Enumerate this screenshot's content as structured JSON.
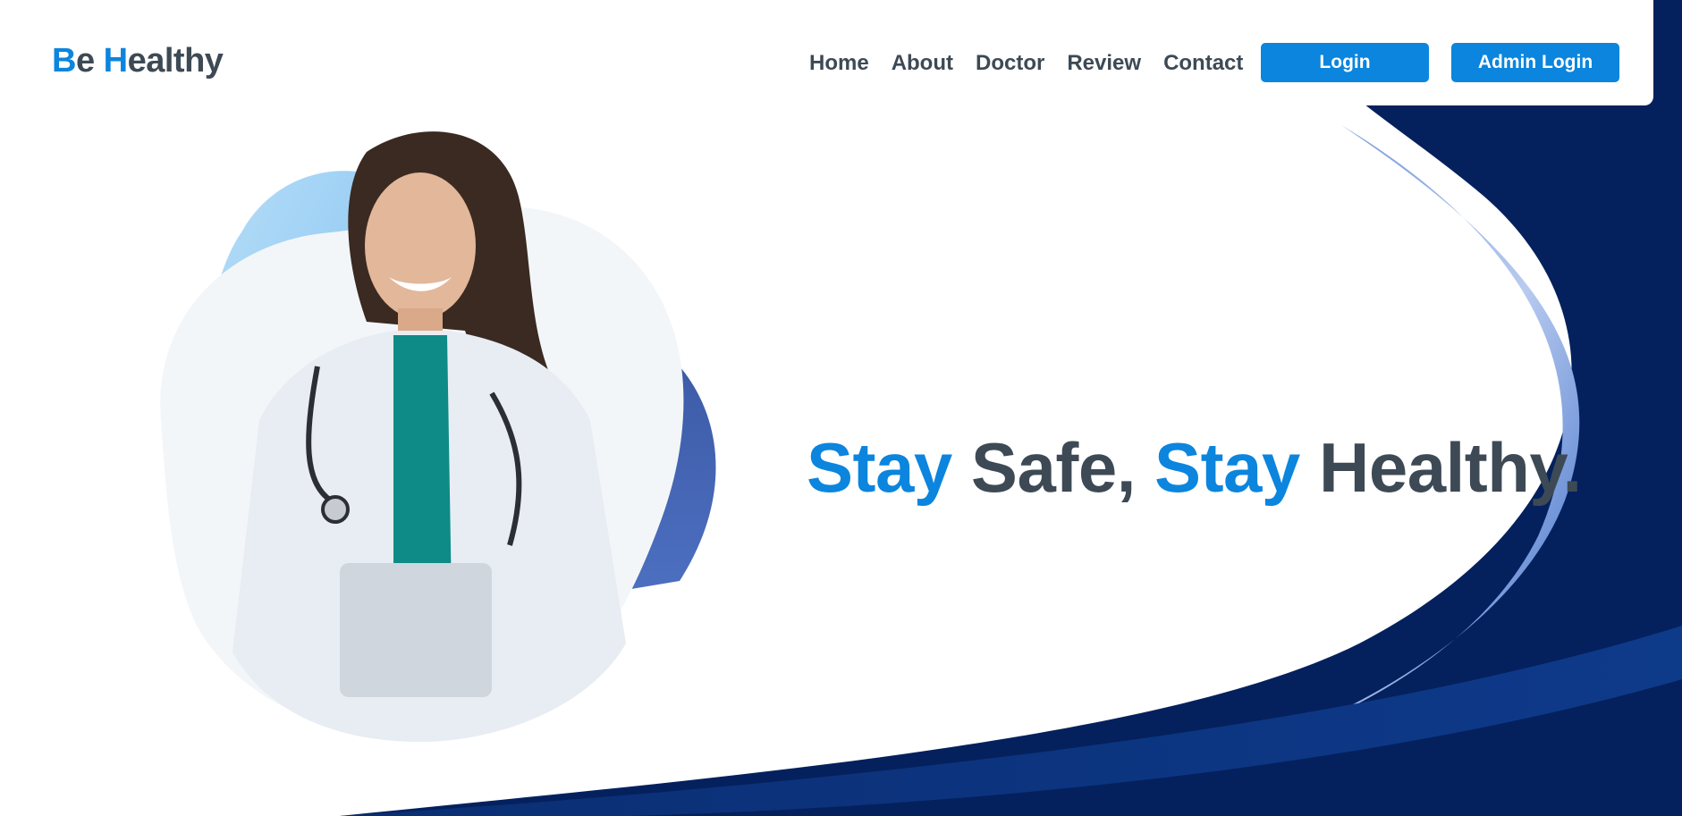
{
  "brand": {
    "logo_parts": [
      {
        "text": "B",
        "accent": true
      },
      {
        "text": "e ",
        "accent": false
      },
      {
        "text": "H",
        "accent": true
      },
      {
        "text": "ealthy",
        "accent": false
      }
    ]
  },
  "nav": {
    "items": [
      "Home",
      "About",
      "Doctor",
      "Review",
      "Contact"
    ],
    "login_label": "Login",
    "admin_login_label": "Admin Login"
  },
  "hero": {
    "headline_parts": [
      {
        "text": "Stay",
        "accent": true
      },
      {
        "text": " Safe, ",
        "accent": false
      },
      {
        "text": "Stay",
        "accent": true
      },
      {
        "text": " Healthy.",
        "accent": false
      }
    ],
    "image_icon": "doctor-portrait"
  },
  "colors": {
    "accent": "#0b85dd",
    "text_dark": "#3d4a55",
    "navy": "#04215e",
    "light_blue": "#9fd2f5"
  }
}
